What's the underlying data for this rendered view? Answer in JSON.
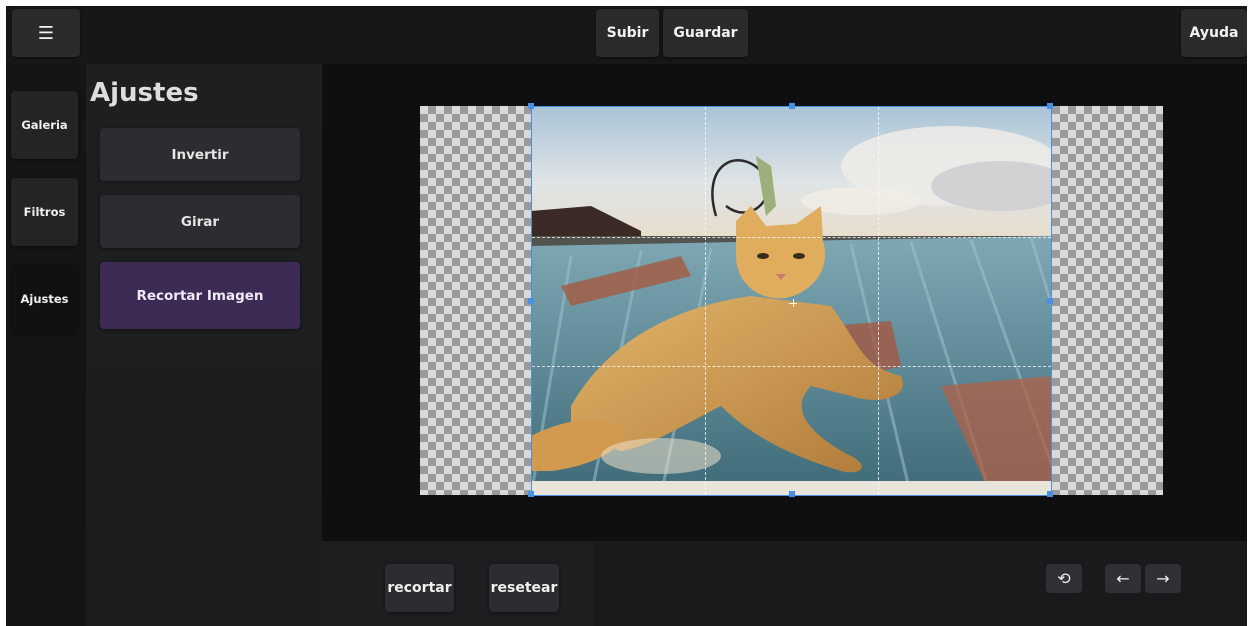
{
  "topbar": {
    "menu_icon": "menu-icon",
    "menu_glyph": "☰",
    "upload_label": "Subir",
    "save_label": "Guardar",
    "help_label": "Ayuda"
  },
  "nav": {
    "items": [
      {
        "label": "Galeria"
      },
      {
        "label": "Filtros"
      },
      {
        "label": "Ajustes",
        "active": true
      }
    ]
  },
  "panel": {
    "title": "Ajustes",
    "buttons": [
      {
        "label": "Invertir"
      },
      {
        "label": "Girar"
      },
      {
        "label": "Recortar Imagen",
        "active": true
      }
    ]
  },
  "editor": {
    "image_subject": "cat-on-roof-photo",
    "crop_grid": "rule-of-thirds"
  },
  "bottombar": {
    "crop_label": "recortar",
    "reset_label": "resetear",
    "undo_glyph": "⟲",
    "prev_glyph": "←",
    "next_glyph": "→"
  },
  "colors": {
    "accent_active": "#3d2b55",
    "crop_frame": "#4a90e2",
    "background": "#151617"
  }
}
